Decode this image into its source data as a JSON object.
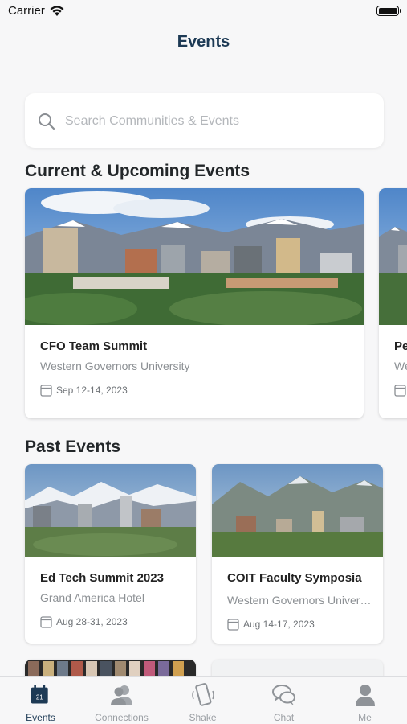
{
  "status_bar": {
    "carrier": "Carrier"
  },
  "nav": {
    "title": "Events"
  },
  "search": {
    "placeholder": "Search Communities & Events"
  },
  "sections": {
    "current": "Current & Upcoming Events",
    "past": "Past Events"
  },
  "current_events": [
    {
      "title": "CFO Team Summit",
      "venue": "Western Governors University",
      "date": "Sep 12-14, 2023"
    },
    {
      "title": "Pe",
      "venue": "We",
      "date": ""
    }
  ],
  "past_events": [
    {
      "title": "Ed Tech Summit 2023",
      "venue": "Grand America Hotel",
      "date": "Aug 28-31, 2023"
    },
    {
      "title": "COIT Faculty Symposia",
      "venue": "Western Governors University",
      "date": "Aug 14-17, 2023"
    }
  ],
  "tabs": [
    {
      "label": "Events",
      "icon": "calendar-icon",
      "badge": "21",
      "active": true
    },
    {
      "label": "Connections",
      "icon": "people-icon"
    },
    {
      "label": "Shake",
      "icon": "shake-phone-icon"
    },
    {
      "label": "Chat",
      "icon": "chat-bubbles-icon"
    },
    {
      "label": "Me",
      "icon": "person-icon"
    }
  ],
  "colors": {
    "accent": "#1d3a55",
    "background": "#f7f7f8",
    "inactive": "#9a9ea3"
  }
}
